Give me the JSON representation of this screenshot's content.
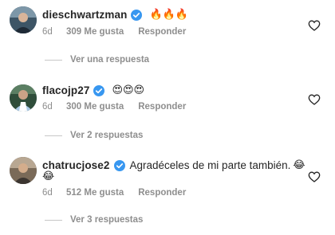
{
  "comments": [
    {
      "username": "dieschwartzman",
      "text": "",
      "emoji": "🔥🔥🔥",
      "age": "6d",
      "likes": "309 Me gusta",
      "reply": "Responder",
      "replies_label": "Ver una respuesta"
    },
    {
      "username": "flacojp27",
      "text": "",
      "emoji": "😍😍😍",
      "age": "6d",
      "likes": "300 Me gusta",
      "reply": "Responder",
      "replies_label": "Ver 2 respuestas"
    },
    {
      "username": "chatrucjose2",
      "text": "Agradéceles de mi parte también.",
      "emoji": "😂",
      "emoji_line2": "😂",
      "age": "6d",
      "likes": "512 Me gusta",
      "reply": "Responder",
      "replies_label": "Ver 3 respuestas"
    }
  ],
  "colors": {
    "verified": "#3897f0",
    "secondary_text": "#8e8e8e",
    "primary_text": "#262626"
  }
}
